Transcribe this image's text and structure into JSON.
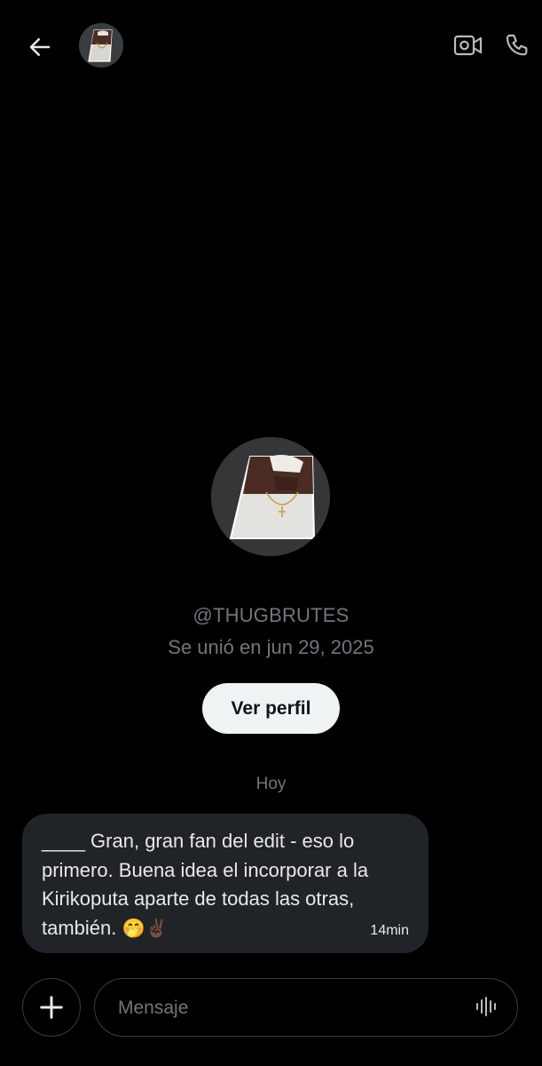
{
  "header": {
    "back_icon": "arrow-left-icon",
    "avatar_alt": "profile avatar",
    "video_icon": "video-camera-icon",
    "call_icon": "phone-icon"
  },
  "profile": {
    "handle": "@THUGBRUTES",
    "joined": "Se unió en jun 29, 2025",
    "button_label": "Ver perfil"
  },
  "conversation": {
    "date_separator": "Hoy",
    "messages": [
      {
        "text": "____ Gran, gran fan del edit - eso lo primero. Buena idea el incorporar a la Kirikoputa aparte de todas las otras, también.",
        "emojis": "🤭✌🏿",
        "time": "14min"
      }
    ]
  },
  "composer": {
    "add_icon": "plus-icon",
    "placeholder": "Mensaje",
    "voice_icon": "voice-waveform-icon"
  },
  "colors": {
    "background": "#000000",
    "bubble": "#202327",
    "secondary_text": "#71767b",
    "button_bg": "#eff3f4"
  }
}
